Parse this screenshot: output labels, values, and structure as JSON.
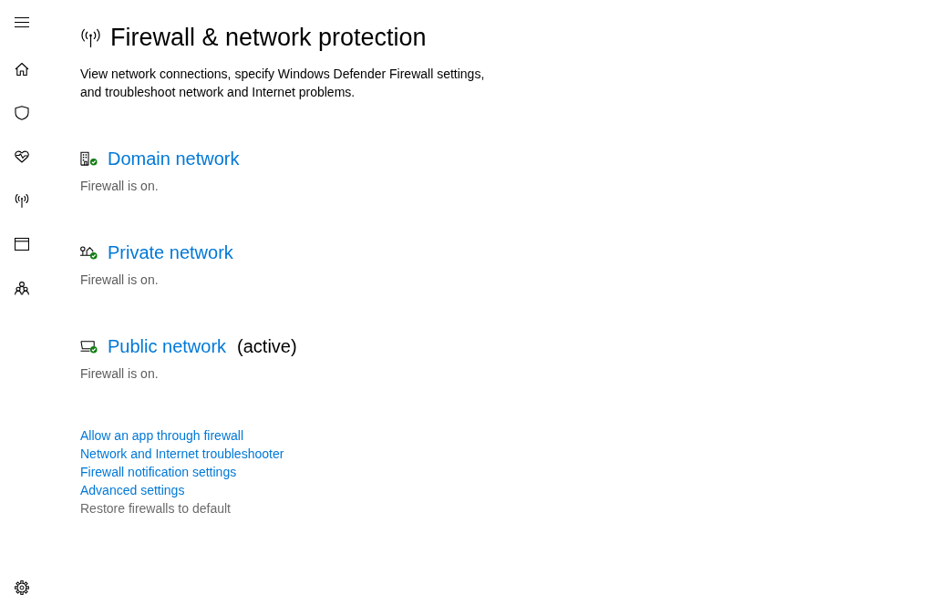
{
  "page": {
    "title": "Firewall & network protection",
    "description": "View network connections, specify Windows Defender Firewall settings, and troubleshoot network and Internet problems."
  },
  "networks": [
    {
      "kind": "domain",
      "name": "Domain network",
      "status": "Firewall is on.",
      "firewall_on": true
    },
    {
      "kind": "private",
      "name": "Private network",
      "status": "Firewall is on.",
      "firewall_on": true
    },
    {
      "kind": "public",
      "name": "Public network",
      "badge": "(active)",
      "status": "Firewall is on.",
      "firewall_on": true
    }
  ],
  "links": [
    {
      "label": "Allow an app through firewall",
      "disabled": false
    },
    {
      "label": "Network and Internet troubleshooter",
      "disabled": false
    },
    {
      "label": "Firewall notification settings",
      "disabled": false
    },
    {
      "label": "Advanced settings",
      "disabled": false
    },
    {
      "label": "Restore firewalls to default",
      "disabled": true
    }
  ]
}
